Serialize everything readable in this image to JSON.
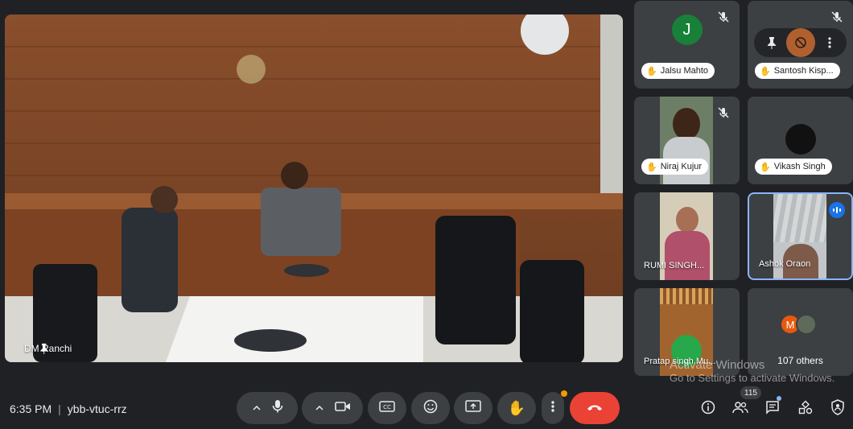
{
  "meeting": {
    "time": "6:35 PM",
    "separator": "|",
    "code": "ybb-vtuc-rrz",
    "participant_count": "115"
  },
  "main_video": {
    "name": "DM Ranchi",
    "pin_icon": "pin-icon"
  },
  "tiles": [
    {
      "name": "Jalsu Mahto",
      "initial": "J",
      "avatar_color": "#188038",
      "muted": true,
      "hand_raised": true
    },
    {
      "name": "Santosh Kisp...",
      "muted": true,
      "hand_raised": true,
      "hover_controls": [
        "pin-icon",
        "remove-icon",
        "more-icon"
      ]
    },
    {
      "name": "Niraj Kujur",
      "muted": true,
      "hand_raised": true
    },
    {
      "name": "Vikash Singh",
      "avatar_color": "#111111",
      "hand_raised": true
    },
    {
      "name": "RUMI SINGH..."
    },
    {
      "name": "Ashok Oraon",
      "speaking": true
    },
    {
      "name": "Pratap singh Mu..."
    },
    {
      "name": "107 others",
      "initial": "M",
      "avatar_color": "#e8590c"
    }
  ],
  "watermark": {
    "line1": "Activate Windows",
    "line2": "Go to Settings to activate Windows."
  },
  "controls": {
    "mic": "microphone-icon",
    "camera": "camera-icon",
    "captions": "captions-icon",
    "emoji": "emoji-icon",
    "present": "present-icon",
    "raise_hand": "hand-icon",
    "more": "more-vert-icon",
    "end_call": "end-call-icon"
  },
  "right_controls": [
    "info-icon",
    "people-icon",
    "chat-icon",
    "activities-icon",
    "host-controls-icon"
  ]
}
